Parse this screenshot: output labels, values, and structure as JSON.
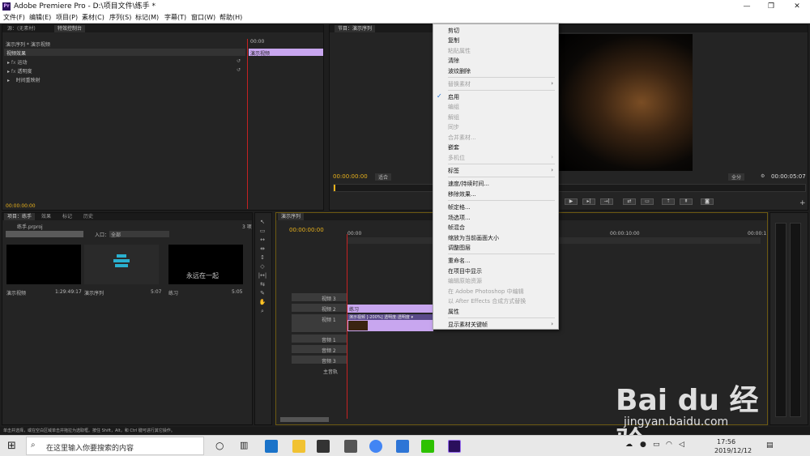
{
  "window": {
    "app_icon": "Pr",
    "title": "Adobe Premiere Pro - D:\\项目文件\\练手 *"
  },
  "menu": [
    "文件(F)",
    "编辑(E)",
    "项目(P)",
    "素材(C)",
    "序列(S)",
    "标记(M)",
    "字幕(T)",
    "窗口(W)",
    "帮助(H)"
  ],
  "source_panel": {
    "tabs": [
      "源：(无素材)",
      "特效控制台"
    ],
    "breadcrumb": "演示序列 * 演示视频",
    "ruler_time": "00:00",
    "section": "视频效果",
    "clip_label": "演示视频",
    "effects": [
      "运动",
      "透明度",
      "时间重映射"
    ],
    "timecode": "00:00:00:00"
  },
  "program_monitor": {
    "tab": "节目：演示序列",
    "current_time": "00:00:00:00",
    "fit": "适合",
    "zoom": "全分",
    "duration": "00:00:05:07"
  },
  "project_panel": {
    "tabs": [
      "项目：练手",
      "效果",
      "标记",
      "历史"
    ],
    "filename": "练手.prproj",
    "count": "3 项",
    "in_label": "入口：",
    "in_value": "全部",
    "items": [
      {
        "name": "演示视频",
        "duration": "1:29:49:17"
      },
      {
        "name": "演示序列",
        "duration": "5:07"
      },
      {
        "name": "练习",
        "duration": "5:05",
        "caption": "永远在一起"
      }
    ]
  },
  "timeline": {
    "tab": "演示序列",
    "timecode": "00:00:00:00",
    "ruler": [
      "00:00",
      "00:00:10:00",
      "00:00:1"
    ],
    "tracks": [
      "视频 3",
      "视频 2",
      "视频 1",
      "音频 1",
      "音频 2",
      "音频 3",
      "主音轨"
    ],
    "clip_title": "练习",
    "clip_label": "演示视频 [-200%]  透明度:透明度 ▾"
  },
  "context_menu": {
    "items": [
      {
        "label": "剪切",
        "enabled": true
      },
      {
        "label": "复制",
        "enabled": true
      },
      {
        "label": "粘贴属性",
        "enabled": false
      },
      {
        "label": "清除",
        "enabled": true
      },
      {
        "label": "波纹删除",
        "enabled": true
      },
      {
        "label": "替换素材",
        "enabled": false,
        "submenu": true
      },
      {
        "label": "启用",
        "enabled": true,
        "checked": true
      },
      {
        "label": "编组",
        "enabled": false
      },
      {
        "label": "解组",
        "enabled": false
      },
      {
        "label": "同步",
        "enabled": false
      },
      {
        "label": "合并素材...",
        "enabled": false
      },
      {
        "label": "嵌套",
        "enabled": true
      },
      {
        "label": "多机位",
        "enabled": false,
        "submenu": true
      },
      {
        "label": "标签",
        "enabled": true,
        "submenu": true
      },
      {
        "label": "速度/持续时间...",
        "enabled": true
      },
      {
        "label": "移除效果...",
        "enabled": true
      },
      {
        "label": "帧定格...",
        "enabled": true
      },
      {
        "label": "场选项...",
        "enabled": true
      },
      {
        "label": "帧混合",
        "enabled": true
      },
      {
        "label": "缩放为当前画面大小",
        "enabled": true
      },
      {
        "label": "调整图层",
        "enabled": true
      },
      {
        "label": "重命名...",
        "enabled": true
      },
      {
        "label": "在项目中显示",
        "enabled": true
      },
      {
        "label": "编辑原始资源",
        "enabled": false
      },
      {
        "label": "在 Adobe Photoshop 中编辑",
        "enabled": false
      },
      {
        "label": "以 After Effects 合成方式替换",
        "enabled": false
      },
      {
        "label": "属性",
        "enabled": true
      },
      {
        "label": "显示素材关键帧",
        "enabled": true,
        "submenu": true
      }
    ]
  },
  "status_bar": "单击并选择，或在空白区域单击并拖拉为选取框。按住 Shift，Alt，和 Ctrl 键可进行其它操作。",
  "taskbar": {
    "search_placeholder": "在这里输入你要搜索的内容",
    "time": "17:56",
    "date": "2019/12/12"
  },
  "watermark": {
    "brand": "Bai du 经验",
    "url": "jingyan.baidu.com"
  },
  "colors": {
    "clip_purple": "#c8a6ef",
    "timecode_yellow": "#e8b11c",
    "playhead_red": "#c42222"
  }
}
